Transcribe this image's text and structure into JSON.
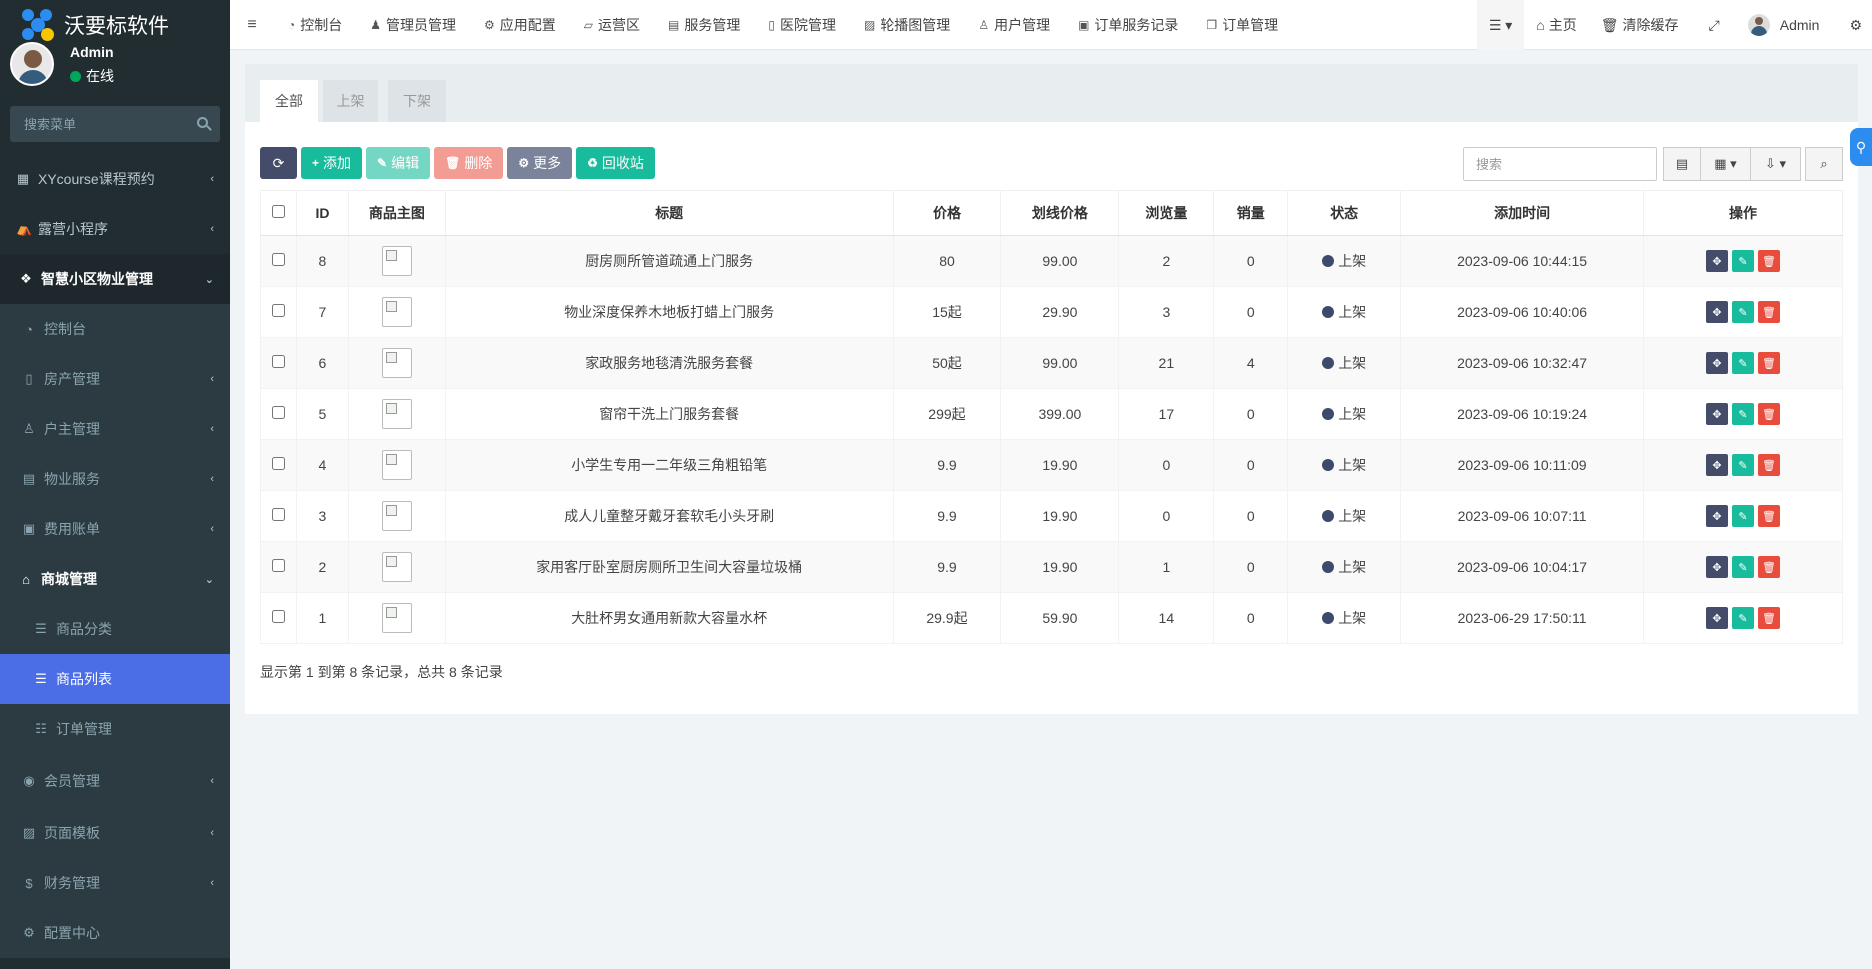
{
  "brand": {
    "name": "沃要标软件"
  },
  "user": {
    "name": "Admin",
    "status": "在线"
  },
  "sidebar": {
    "search_placeholder": "搜索菜单",
    "items": [
      {
        "label": "XYcourse课程预约",
        "icon": "grid-icon",
        "level": "top"
      },
      {
        "label": "露营小程序",
        "icon": "tent-icon",
        "level": "top"
      },
      {
        "label": "智慧小区物业管理",
        "icon": "cubes-icon",
        "level": "top-open"
      },
      {
        "label": "控制台",
        "icon": "dashboard-icon",
        "level": "sub"
      },
      {
        "label": "房产管理",
        "icon": "building-icon",
        "level": "sub"
      },
      {
        "label": "户主管理",
        "icon": "user-icon",
        "level": "sub"
      },
      {
        "label": "物业服务",
        "icon": "server-icon",
        "level": "sub"
      },
      {
        "label": "费用账单",
        "icon": "calendar-icon",
        "level": "sub"
      },
      {
        "label": "商城管理",
        "icon": "bank-icon",
        "level": "top-open"
      },
      {
        "label": "商品分类",
        "icon": "list-icon",
        "level": "sub2"
      },
      {
        "label": "商品列表",
        "icon": "list-icon",
        "level": "sub2-active"
      },
      {
        "label": "订单管理",
        "icon": "list-ol-icon",
        "level": "sub2"
      },
      {
        "label": "会员管理",
        "icon": "user-circle-icon",
        "level": "sub"
      },
      {
        "label": "页面模板",
        "icon": "image-icon",
        "level": "sub"
      },
      {
        "label": "财务管理",
        "icon": "dollar-icon",
        "level": "sub"
      },
      {
        "label": "配置中心",
        "icon": "gear-icon",
        "level": "sub"
      }
    ]
  },
  "topnav": {
    "tabs": [
      {
        "label": "控制台",
        "icon": "dashboard-icon"
      },
      {
        "label": "管理员管理",
        "icon": "user-icon"
      },
      {
        "label": "应用配置",
        "icon": "gear-icon"
      },
      {
        "label": "运营区",
        "icon": "map-icon"
      },
      {
        "label": "服务管理",
        "icon": "list-alt-icon"
      },
      {
        "label": "医院管理",
        "icon": "clipboard-icon"
      },
      {
        "label": "轮播图管理",
        "icon": "image-icon"
      },
      {
        "label": "用户管理",
        "icon": "user-o-icon"
      },
      {
        "label": "订单服务记录",
        "icon": "save-icon"
      },
      {
        "label": "订单管理",
        "icon": "clone-icon"
      }
    ],
    "right": {
      "home": "主页",
      "clear_cache": "清除缓存",
      "admin": "Admin"
    }
  },
  "content_tabs": [
    "全部",
    "上架",
    "下架"
  ],
  "toolbar": {
    "add": "添加",
    "edit": "编辑",
    "delete": "删除",
    "more": "更多",
    "recycle": "回收站"
  },
  "search": {
    "placeholder": "搜索"
  },
  "table": {
    "headers": [
      "ID",
      "商品主图",
      "标题",
      "价格",
      "划线价格",
      "浏览量",
      "销量",
      "状态",
      "添加时间",
      "操作"
    ],
    "rows": [
      {
        "id": "8",
        "title": "厨房厕所管道疏通上门服务",
        "price": "80",
        "orig": "99.00",
        "views": "2",
        "sales": "0",
        "status": "上架",
        "time": "2023-09-06 10:44:15"
      },
      {
        "id": "7",
        "title": "物业深度保养木地板打蜡上门服务",
        "price": "15起",
        "orig": "29.90",
        "views": "3",
        "sales": "0",
        "status": "上架",
        "time": "2023-09-06 10:40:06"
      },
      {
        "id": "6",
        "title": "家政服务地毯清洗服务套餐",
        "price": "50起",
        "orig": "99.00",
        "views": "21",
        "sales": "4",
        "status": "上架",
        "time": "2023-09-06 10:32:47"
      },
      {
        "id": "5",
        "title": "窗帘干洗上门服务套餐",
        "price": "299起",
        "orig": "399.00",
        "views": "17",
        "sales": "0",
        "status": "上架",
        "time": "2023-09-06 10:19:24"
      },
      {
        "id": "4",
        "title": "小学生专用一二年级三角粗铅笔",
        "price": "9.9",
        "orig": "19.90",
        "views": "0",
        "sales": "0",
        "status": "上架",
        "time": "2023-09-06 10:11:09"
      },
      {
        "id": "3",
        "title": "成人儿童整牙戴牙套软毛小头牙刷",
        "price": "9.9",
        "orig": "19.90",
        "views": "0",
        "sales": "0",
        "status": "上架",
        "time": "2023-09-06 10:07:11"
      },
      {
        "id": "2",
        "title": "家用客厅卧室厨房厕所卫生间大容量垃圾桶",
        "price": "9.9",
        "orig": "19.90",
        "views": "1",
        "sales": "0",
        "status": "上架",
        "time": "2023-09-06 10:04:17"
      },
      {
        "id": "1",
        "title": "大肚杯男女通用新款大容量水杯",
        "price": "29.9起",
        "orig": "59.90",
        "views": "14",
        "sales": "0",
        "status": "上架",
        "time": "2023-06-29 17:50:11"
      }
    ]
  },
  "pager": {
    "info": "显示第 1 到第 8 条记录，总共 8 条记录"
  },
  "colors": {
    "sidebar": "#222d32",
    "active": "#4b6ee6",
    "green": "#18bc9c",
    "dark": "#444c69",
    "red": "#e74c3c"
  }
}
